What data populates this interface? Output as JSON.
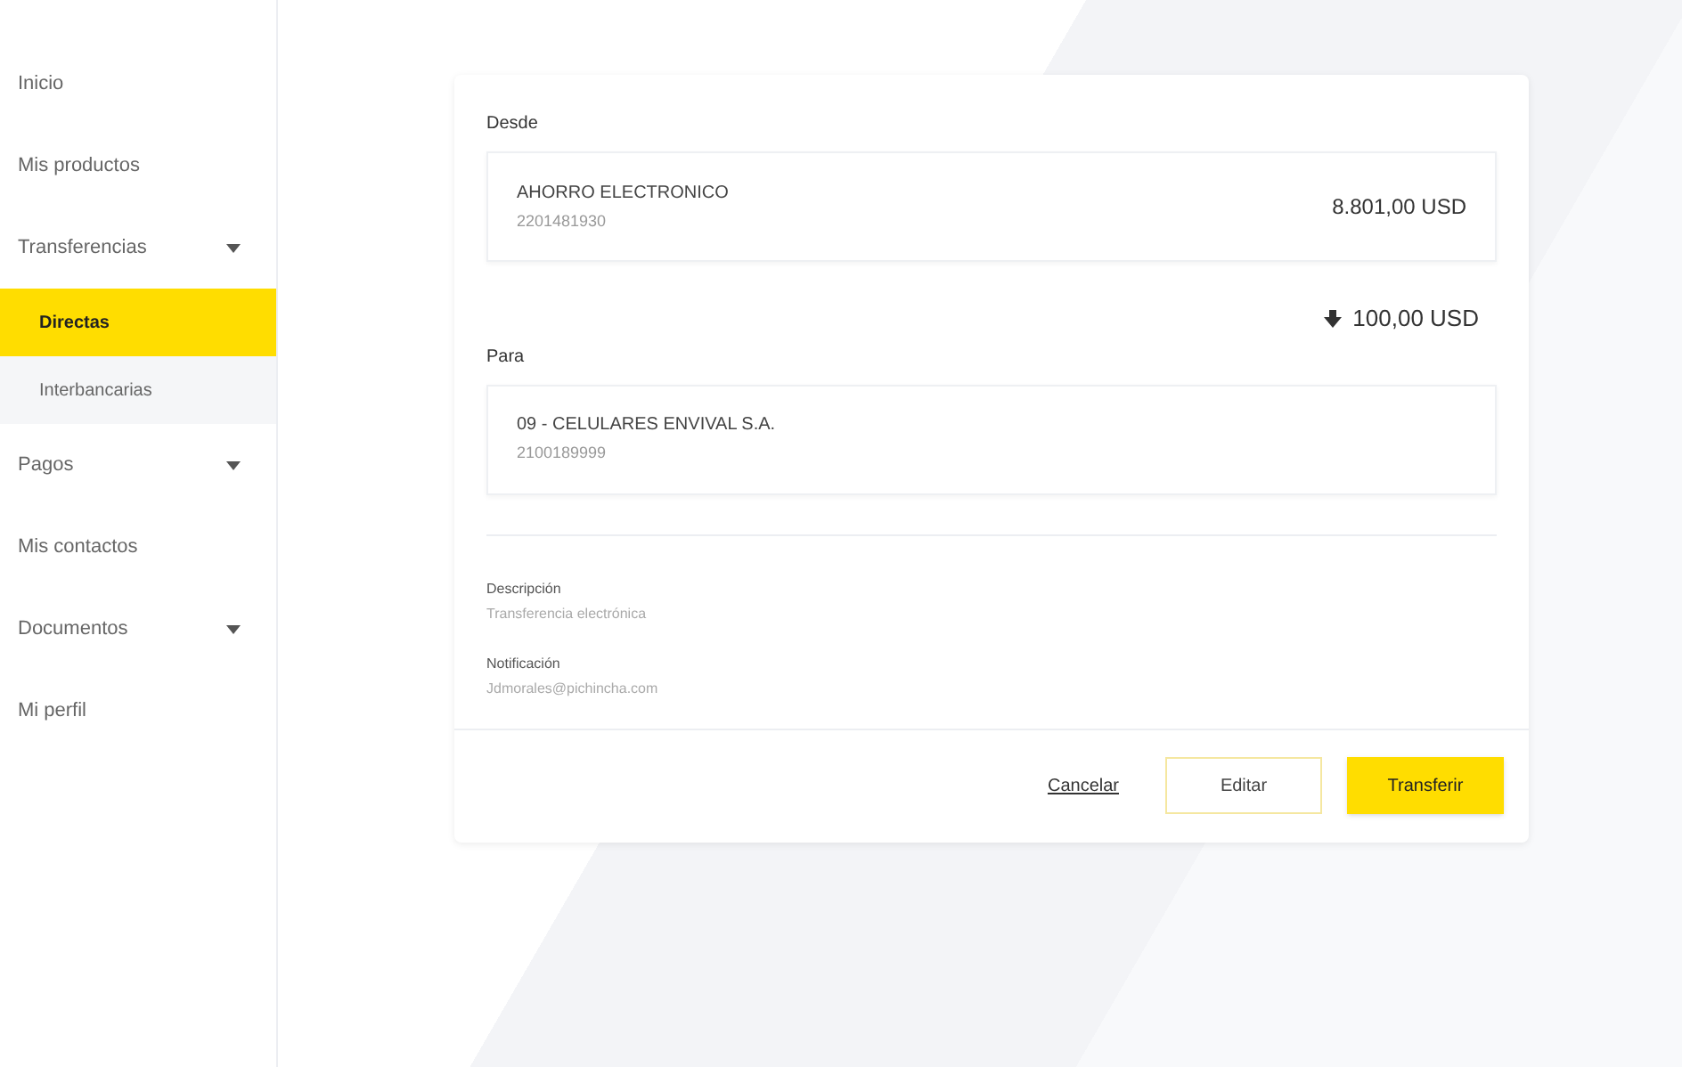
{
  "sidebar": {
    "items": [
      {
        "label": "Inicio",
        "expandable": false
      },
      {
        "label": "Mis productos",
        "expandable": false
      },
      {
        "label": "Transferencias",
        "expandable": true,
        "children": [
          {
            "label": "Directas",
            "selected": true
          },
          {
            "label": "Interbancarias",
            "selected": false
          }
        ]
      },
      {
        "label": "Pagos",
        "expandable": true
      },
      {
        "label": "Mis contactos",
        "expandable": false
      },
      {
        "label": "Documentos",
        "expandable": true
      },
      {
        "label": "Mi perfil",
        "expandable": false
      }
    ]
  },
  "form": {
    "from_label": "Desde",
    "from_account": {
      "name": "AHORRO ELECTRONICO",
      "number": "2201481930",
      "balance": "8.801,00 USD"
    },
    "amount": "100,00 USD",
    "to_label": "Para",
    "to_account": {
      "name": "09 - CELULARES ENVIVAL S.A.",
      "number": "2100189999"
    },
    "details": [
      {
        "label": "Descripción",
        "value": "Transferencia electrónica"
      },
      {
        "label": "Notificación",
        "value": "Jdmorales@pichincha.com"
      }
    ],
    "buttons": [
      {
        "label": "Cancelar",
        "kind": "link"
      },
      {
        "label": "Editar",
        "kind": "outline"
      },
      {
        "label": "Transferir",
        "kind": "primary"
      }
    ]
  }
}
